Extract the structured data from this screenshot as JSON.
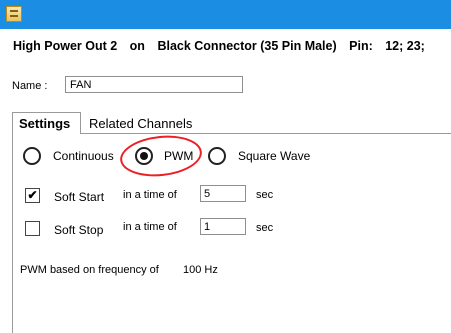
{
  "header": {
    "channel": "High Power Out 2",
    "on": "on",
    "connector": "Black Connector (35 Pin Male)",
    "pin_label": "Pin:",
    "pins": "12;  23;"
  },
  "name": {
    "label": "Name :",
    "value": "FAN"
  },
  "tabs": [
    {
      "label": "Settings",
      "active": true
    },
    {
      "label": "Related Channels",
      "active": false
    }
  ],
  "mode": {
    "options": [
      "Continuous",
      "PWM",
      "Square Wave"
    ],
    "selected": "PWM"
  },
  "soft_start": {
    "label": "Soft Start",
    "checked": true,
    "time_label": "in a time of",
    "value": "5",
    "unit": "sec"
  },
  "soft_stop": {
    "label": "Soft Stop",
    "checked": false,
    "time_label": "in a time of",
    "value": "1",
    "unit": "sec"
  },
  "pwm_info": {
    "text": "PWM based on frequency of",
    "frequency": "100 Hz"
  },
  "colors": {
    "titlebar": "#1b8de3",
    "highlight": "#ec1f25"
  }
}
